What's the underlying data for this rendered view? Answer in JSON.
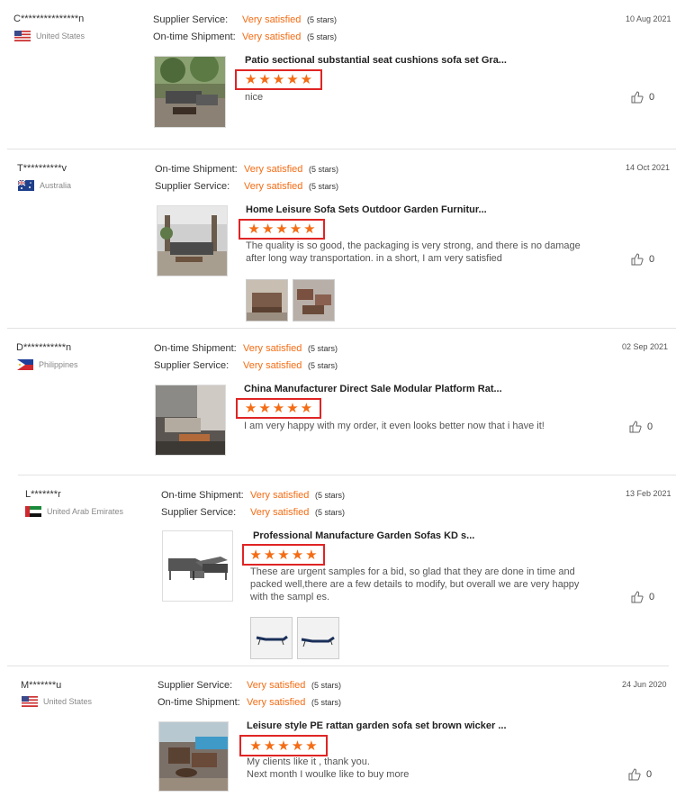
{
  "reviews": [
    {
      "user": "C***************n",
      "country": "United States",
      "flag": "us",
      "date": "10 Aug 2021",
      "ratings": [
        {
          "label": "Supplier Service:",
          "value": "Very satisfied",
          "stars": "(5 stars)"
        },
        {
          "label": "On-time Shipment:",
          "value": "Very satisfied",
          "stars": "(5 stars)"
        }
      ],
      "product": "Patio sectional substantial seat cushions sofa set Gra...",
      "comment": "nice",
      "likes": "0"
    },
    {
      "user": "T**********v",
      "country": "Australia",
      "flag": "au",
      "date": "14 Oct 2021",
      "ratings": [
        {
          "label": "On-time Shipment:",
          "value": "Very satisfied",
          "stars": "(5 stars)"
        },
        {
          "label": "Supplier Service:",
          "value": "Very satisfied",
          "stars": "(5 stars)"
        }
      ],
      "product": "Home Leisure Sofa Sets Outdoor Garden Furnitur...",
      "comment": "The quality is so good, the packaging is very strong, and there is no damage after long way transportation. in a short, I am very satisfied",
      "likes": "0"
    },
    {
      "user": "D***********n",
      "country": "Philippines",
      "flag": "ph",
      "date": "02 Sep 2021",
      "ratings": [
        {
          "label": "On-time Shipment:",
          "value": "Very satisfied",
          "stars": "(5 stars)"
        },
        {
          "label": "Supplier Service:",
          "value": "Very satisfied",
          "stars": "(5 stars)"
        }
      ],
      "product": "China Manufacturer Direct Sale Modular Platform Rat...",
      "comment": "I am very happy with my order, it even looks better now that i have it!",
      "likes": "0"
    },
    {
      "user": "L*******r",
      "country": "United Arab Emirates",
      "flag": "ae",
      "date": "13 Feb 2021",
      "ratings": [
        {
          "label": "On-time Shipment:",
          "value": "Very satisfied",
          "stars": "(5 stars)"
        },
        {
          "label": "Supplier Service:",
          "value": "Very satisfied",
          "stars": "(5 stars)"
        }
      ],
      "product": "Professional Manufacture Garden Sofas KD s...",
      "comment": "These are urgent samples for a bid, so glad that they are done in time and packed well,there are a few details to modify, but overall we are very happy with the sampl es.",
      "likes": "0"
    },
    {
      "user": "M*******u",
      "country": "United States",
      "flag": "us",
      "date": "24 Jun 2020",
      "ratings": [
        {
          "label": "Supplier Service:",
          "value": "Very satisfied",
          "stars": "(5 stars)"
        },
        {
          "label": "On-time Shipment:",
          "value": "Very satisfied",
          "stars": "(5 stars)"
        }
      ],
      "product": "Leisure style PE rattan garden sofa set brown wicker ...",
      "comment_lines": [
        "My clients  like it , thank you.",
        "Next month I woulke like to buy more"
      ],
      "likes": "0"
    }
  ],
  "colors": {
    "accent": "#f46c14",
    "highlight_box": "#e02424"
  }
}
